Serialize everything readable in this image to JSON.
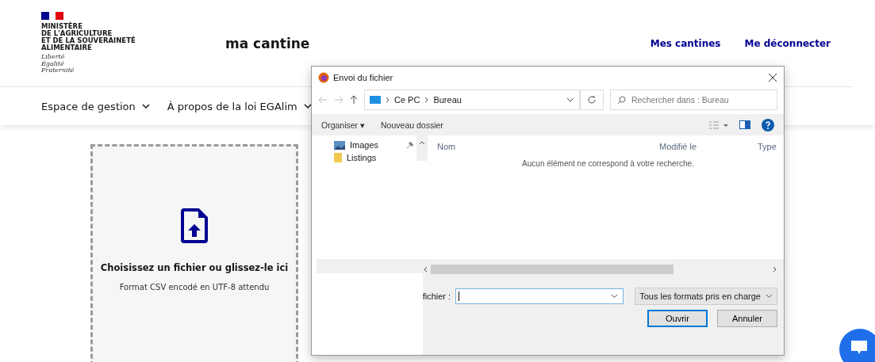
{
  "header": {
    "ministry": [
      "MINISTÈRE",
      "DE L'AGRICULTURE",
      "ET DE LA SOUVERAINETÉ",
      "ALIMENTAIRE"
    ],
    "motto": [
      "Liberté",
      "Égalité",
      "Fraternité"
    ],
    "site_title": "ma cantine",
    "links": [
      "Mes cantines",
      "Me déconnecter"
    ]
  },
  "nav": [
    "Espace de gestion",
    "À propos de la loi EGAlim"
  ],
  "dropzone": {
    "title": "Choisissez un fichier ou glissez-le ici",
    "hint": "Format CSV encodé en UTF-8 attendu"
  },
  "dialog": {
    "title": "Envoi du fichier",
    "path": [
      "Ce PC",
      "Bureau"
    ],
    "search": {
      "placeholder": "Rechercher dans : Bureau"
    },
    "toolbar": [
      "Organiser ▾",
      "Nouveau dossier"
    ],
    "sidebar": [
      {
        "label": "Images",
        "kind": "images",
        "pinned": true
      },
      {
        "label": "Listings",
        "kind": "folder",
        "pinned": false
      }
    ],
    "columns": [
      "Nom",
      "Modifié le",
      "Type"
    ],
    "empty_message": "Aucun élément ne correspond à votre recherche.",
    "filename_label": "fichier :",
    "filetype": "Tous les formats pris en charge",
    "buttons": [
      {
        "label": "Ouvrir",
        "default": true
      },
      {
        "label": "Annuler",
        "default": false
      }
    ]
  }
}
